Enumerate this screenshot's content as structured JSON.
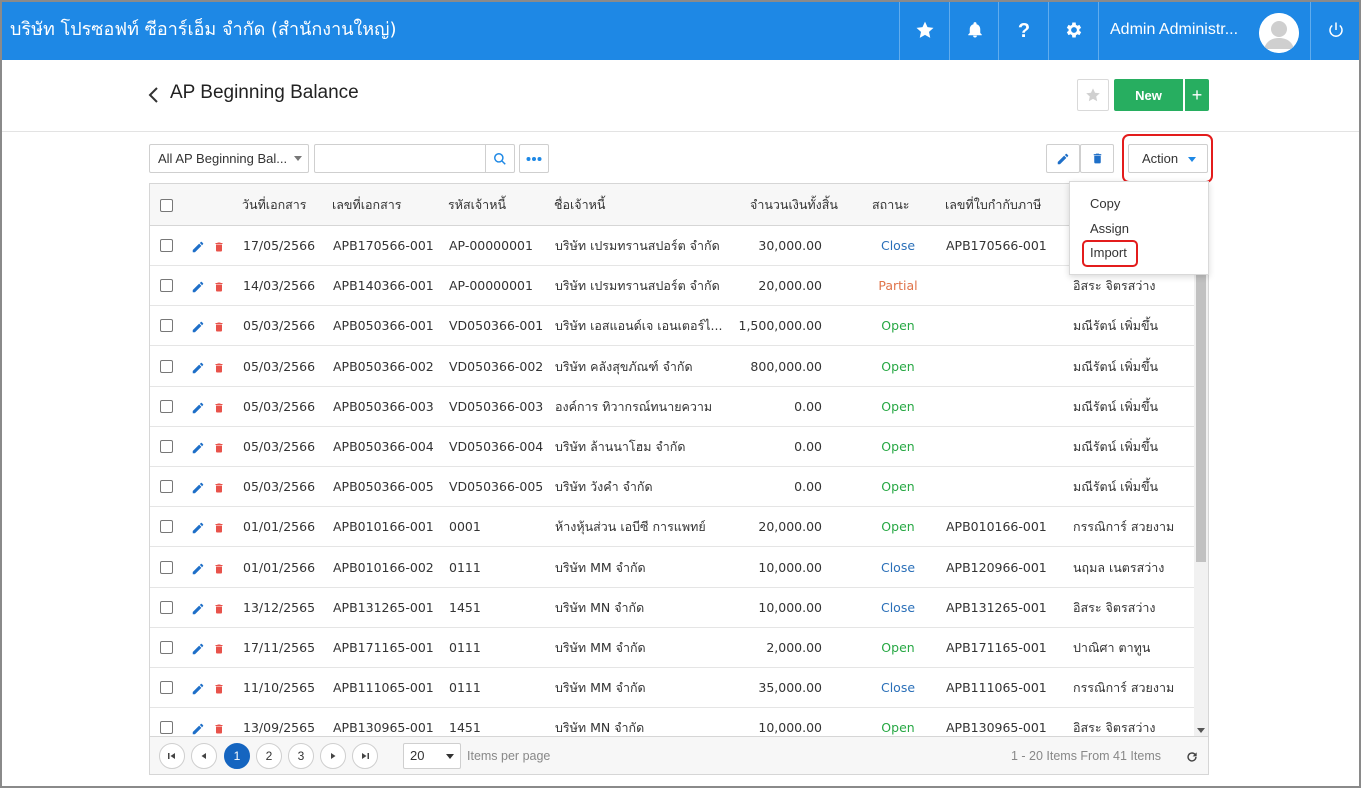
{
  "topbar": {
    "company": "บริษัท โปรซอฟท์ ซีอาร์เอ็ม จำกัด (สำนักงานใหญ่)",
    "user_name": "Admin Administr...",
    "icons": [
      "star-icon",
      "bell-icon",
      "help-icon",
      "gear-icon",
      "power-icon"
    ]
  },
  "page": {
    "title": "AP Beginning Balance",
    "new_label": "New",
    "plus_label": "+"
  },
  "toolbar": {
    "filter_value": "All AP Beginning Bal...",
    "search_value": "",
    "action_label": "Action"
  },
  "action_menu": {
    "items": [
      "Copy",
      "Assign",
      "Import"
    ]
  },
  "table": {
    "headers": [
      "วันที่เอกสาร",
      "เลขที่เอกสาร",
      "รหัสเจ้าหนี้",
      "ชื่อเจ้าหนี้",
      "จำนวนเงินทั้งสิ้น",
      "สถานะ",
      "เลขที่ใบกำกับภาษี",
      ""
    ],
    "rows": [
      {
        "date": "17/05/2566",
        "doc": "APB170566-001",
        "code": "AP-00000001",
        "name": "บริษัท เปรมทรานสปอร์ต จำกัด",
        "amount": "30,000.00",
        "status": "Close",
        "tax": "APB170566-001",
        "owner": ""
      },
      {
        "date": "14/03/2566",
        "doc": "APB140366-001",
        "code": "AP-00000001",
        "name": "บริษัท เปรมทรานสปอร์ต จำกัด",
        "amount": "20,000.00",
        "status": "Partial",
        "tax": "",
        "owner": "อิสระ จิตรสว่าง"
      },
      {
        "date": "05/03/2566",
        "doc": "APB050366-001",
        "code": "VD050366-001",
        "name": "บริษัท เอสแอนด์เจ เอนเตอร์ไ...",
        "amount": "1,500,000.00",
        "status": "Open",
        "tax": "",
        "owner": "มณีรัตน์ เพิ่มขึ้น"
      },
      {
        "date": "05/03/2566",
        "doc": "APB050366-002",
        "code": "VD050366-002",
        "name": "บริษัท คลังสุขภัณฑ์ จำกัด",
        "amount": "800,000.00",
        "status": "Open",
        "tax": "",
        "owner": "มณีรัตน์ เพิ่มขึ้น"
      },
      {
        "date": "05/03/2566",
        "doc": "APB050366-003",
        "code": "VD050366-003",
        "name": "องค์การ ทิวากรณ์ทนายความ",
        "amount": "0.00",
        "status": "Open",
        "tax": "",
        "owner": "มณีรัตน์ เพิ่มขึ้น"
      },
      {
        "date": "05/03/2566",
        "doc": "APB050366-004",
        "code": "VD050366-004",
        "name": "บริษัท ล้านนาโฮม จำกัด",
        "amount": "0.00",
        "status": "Open",
        "tax": "",
        "owner": "มณีรัตน์ เพิ่มขึ้น"
      },
      {
        "date": "05/03/2566",
        "doc": "APB050366-005",
        "code": "VD050366-005",
        "name": "บริษัท วังคำ จำกัด",
        "amount": "0.00",
        "status": "Open",
        "tax": "",
        "owner": "มณีรัตน์ เพิ่มขึ้น"
      },
      {
        "date": "01/01/2566",
        "doc": "APB010166-001",
        "code": "0001",
        "name": "ห้างหุ้นส่วน เอบีซี การแพทย์",
        "amount": "20,000.00",
        "status": "Open",
        "tax": "APB010166-001",
        "owner": "กรรณิการ์ สวยงาม"
      },
      {
        "date": "01/01/2566",
        "doc": "APB010166-002",
        "code": "0111",
        "name": "บริษัท MM จำกัด",
        "amount": "10,000.00",
        "status": "Close",
        "tax": "APB120966-001",
        "owner": "นฤมล เนตรสว่าง"
      },
      {
        "date": "13/12/2565",
        "doc": "APB131265-001",
        "code": "1451",
        "name": "บริษัท MN จำกัด",
        "amount": "10,000.00",
        "status": "Close",
        "tax": "APB131265-001",
        "owner": "อิสระ จิตรสว่าง"
      },
      {
        "date": "17/11/2565",
        "doc": "APB171165-001",
        "code": "0111",
        "name": "บริษัท MM จำกัด",
        "amount": "2,000.00",
        "status": "Open",
        "tax": "APB171165-001",
        "owner": "ปาณิศา ตาทูน"
      },
      {
        "date": "11/10/2565",
        "doc": "APB111065-001",
        "code": "0111",
        "name": "บริษัท MM จำกัด",
        "amount": "35,000.00",
        "status": "Close",
        "tax": "APB111065-001",
        "owner": "กรรณิการ์ สวยงาม"
      },
      {
        "date": "13/09/2565",
        "doc": "APB130965-001",
        "code": "1451",
        "name": "บริษัท MN จำกัด",
        "amount": "10,000.00",
        "status": "Open",
        "tax": "APB130965-001",
        "owner": "อิสระ จิตรสว่าง"
      }
    ]
  },
  "pager": {
    "pages": [
      "1",
      "2",
      "3"
    ],
    "active_page": "1",
    "per_page": "20",
    "per_page_label": "Items per page",
    "info": "1 - 20 Items From 41 Items"
  },
  "colors": {
    "topbar": "#1e88e5",
    "new_button": "#27ae60",
    "status_close": "#2a6fb8",
    "status_open": "#27a844",
    "status_partial": "#e0744a",
    "highlight": "#e31c1c"
  }
}
